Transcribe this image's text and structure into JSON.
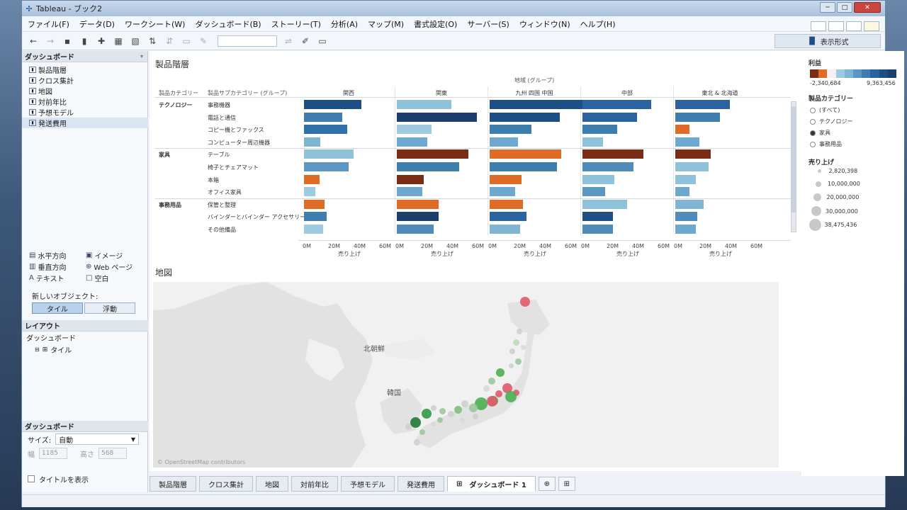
{
  "window": {
    "title": "Tableau - ブック2"
  },
  "menu": [
    "ファイル(F)",
    "データ(D)",
    "ワークシート(W)",
    "ダッシュボード(B)",
    "ストーリー(T)",
    "分析(A)",
    "マップ(M)",
    "書式設定(O)",
    "サーバー(S)",
    "ウィンドウ(N)",
    "ヘルプ(H)"
  ],
  "toolbar": {
    "show_me": "表示形式"
  },
  "left": {
    "dashboard_header": "ダッシュボード",
    "sheets": [
      "製品階層",
      "クロス集計",
      "地図",
      "対前年比",
      "予想モデル",
      "発送費用"
    ],
    "objects": [
      [
        "水平方向",
        "イメージ"
      ],
      [
        "垂直方向",
        "Web ページ"
      ],
      [
        "テキスト",
        "空白"
      ]
    ],
    "new_object_label": "新しいオブジェクト:",
    "tile_label": "タイル",
    "float_label": "浮動",
    "layout_header": "レイアウト",
    "layout_dashboard": "ダッシュボード",
    "layout_tile": "タイル",
    "dash_header": "ダッシュボード",
    "size_label": "サイズ:",
    "size_value": "自動",
    "width_label": "幅",
    "width_value": "1185",
    "height_label": "高さ",
    "height_value": "568",
    "show_title": "タイトルを表示"
  },
  "chart": {
    "title": "製品階層",
    "region_group_label": "地域 (グループ)",
    "col_category": "製品カテゴリー",
    "col_subcategory": "製品サブカテゴリー (グループ)",
    "regions": [
      "関西",
      "関東",
      "九州 四国 中国",
      "中部",
      "東北 & 北海道"
    ],
    "categories": [
      "テクノロジー",
      "家具",
      "事務用品"
    ],
    "subcategories": [
      "事務機器",
      "電話と通信",
      "コピー機とファックス",
      "コンピューター周辺機器",
      "テーブル",
      "椅子とチェアマット",
      "本箱",
      "オフィス家具",
      "保管と整理",
      "バインダーとバインダー アクセサリー",
      "その他備品"
    ],
    "axis_ticks": [
      "0M",
      "20M",
      "40M",
      "60M"
    ],
    "axis_label": "売り上げ"
  },
  "chart_data": {
    "type": "bar",
    "title": "製品階層",
    "x_axis_label": "売り上げ",
    "xlim": [
      0,
      70
    ],
    "regions": [
      "関西",
      "関東",
      "九州 四国 中国",
      "中部",
      "東北 & 北海道"
    ],
    "categories": [
      "事務機器",
      "電話と通信",
      "コピー機とファックス",
      "コンピューター周辺機器",
      "テーブル",
      "椅子とチェアマット",
      "本箱",
      "オフィス家具",
      "保管と整理",
      "バインダーとバインダー アクセサリー",
      "その他備品"
    ],
    "series": [
      {
        "region": "関西",
        "values": [
          45,
          30,
          34,
          13,
          39,
          35,
          12,
          9,
          16,
          18,
          15
        ],
        "profit_colors": [
          "#1d4f86",
          "#3d7eae",
          "#2f72a9",
          "#7fb4d2",
          "#8ec1da",
          "#5b97c2",
          "#e06b26",
          "#9dcae0",
          "#e06b26",
          "#3d7eae",
          "#9dcae0"
        ]
      },
      {
        "region": "関東",
        "values": [
          43,
          63,
          27,
          24,
          56,
          49,
          21,
          20,
          33,
          33,
          29
        ],
        "profit_colors": [
          "#8ec1da",
          "#1d3e6d",
          "#9dcae0",
          "#6fa8ce",
          "#7a2d14",
          "#3d7eae",
          "#7a2d14",
          "#6fa8ce",
          "#e06b26",
          "#1d3e6d",
          "#4f8cbc"
        ]
      },
      {
        "region": "九州 四国 中国",
        "values": [
          73,
          55,
          33,
          22,
          56,
          53,
          25,
          20,
          26,
          29,
          24
        ],
        "profit_colors": [
          "#1d4f86",
          "#1d4f86",
          "#3d7eae",
          "#6fa8ce",
          "#e06b26",
          "#3d7eae",
          "#e06b26",
          "#6fa8ce",
          "#e06b26",
          "#2a63a0",
          "#7fb4d2"
        ]
      },
      {
        "region": "中部",
        "values": [
          54,
          43,
          27,
          16,
          48,
          40,
          25,
          18,
          35,
          24,
          24
        ],
        "profit_colors": [
          "#2a63a0",
          "#2a63a0",
          "#3d7eae",
          "#8ec1da",
          "#7a2d14",
          "#4f8cbc",
          "#8ec1da",
          "#5b97c2",
          "#8ec1da",
          "#1d4f86",
          "#4f8cbc"
        ]
      },
      {
        "region": "東北 & 北海道",
        "values": [
          43,
          35,
          11,
          19,
          28,
          26,
          16,
          11,
          22,
          17,
          16
        ],
        "profit_colors": [
          "#2a63a0",
          "#3d7eae",
          "#e06b26",
          "#6fa8ce",
          "#7a2d14",
          "#8ec1da",
          "#8ec1da",
          "#6fa8ce",
          "#7fb4d2",
          "#4f8cbc",
          "#6fa8ce"
        ]
      }
    ]
  },
  "map": {
    "title": "地図",
    "labels": [
      "北朝鮮",
      "韓国"
    ],
    "attribution": "© OpenStreetMap contributors"
  },
  "legend": {
    "profit_title": "利益",
    "profit_min": "-2,340,684",
    "profit_max": "9,363,456",
    "category_title": "製品カテゴリー",
    "category_options": [
      "(すべて)",
      "テクノロジー",
      "家具",
      "事務用品"
    ],
    "category_selected": "家具",
    "sales_title": "売り上げ",
    "sales_sizes": [
      "2,820,398",
      "10,000,000",
      "20,000,000",
      "30,000,000",
      "38,475,436"
    ]
  },
  "tabs": [
    "製品階層",
    "クロス集計",
    "地図",
    "対前年比",
    "予想モデル",
    "発送費用",
    "ダッシュボード 1"
  ],
  "colors": {
    "accent_blue": "#1d4f86",
    "orange": "#e06b26",
    "brown": "#7a2d14",
    "light_blue": "#8ec1da"
  }
}
